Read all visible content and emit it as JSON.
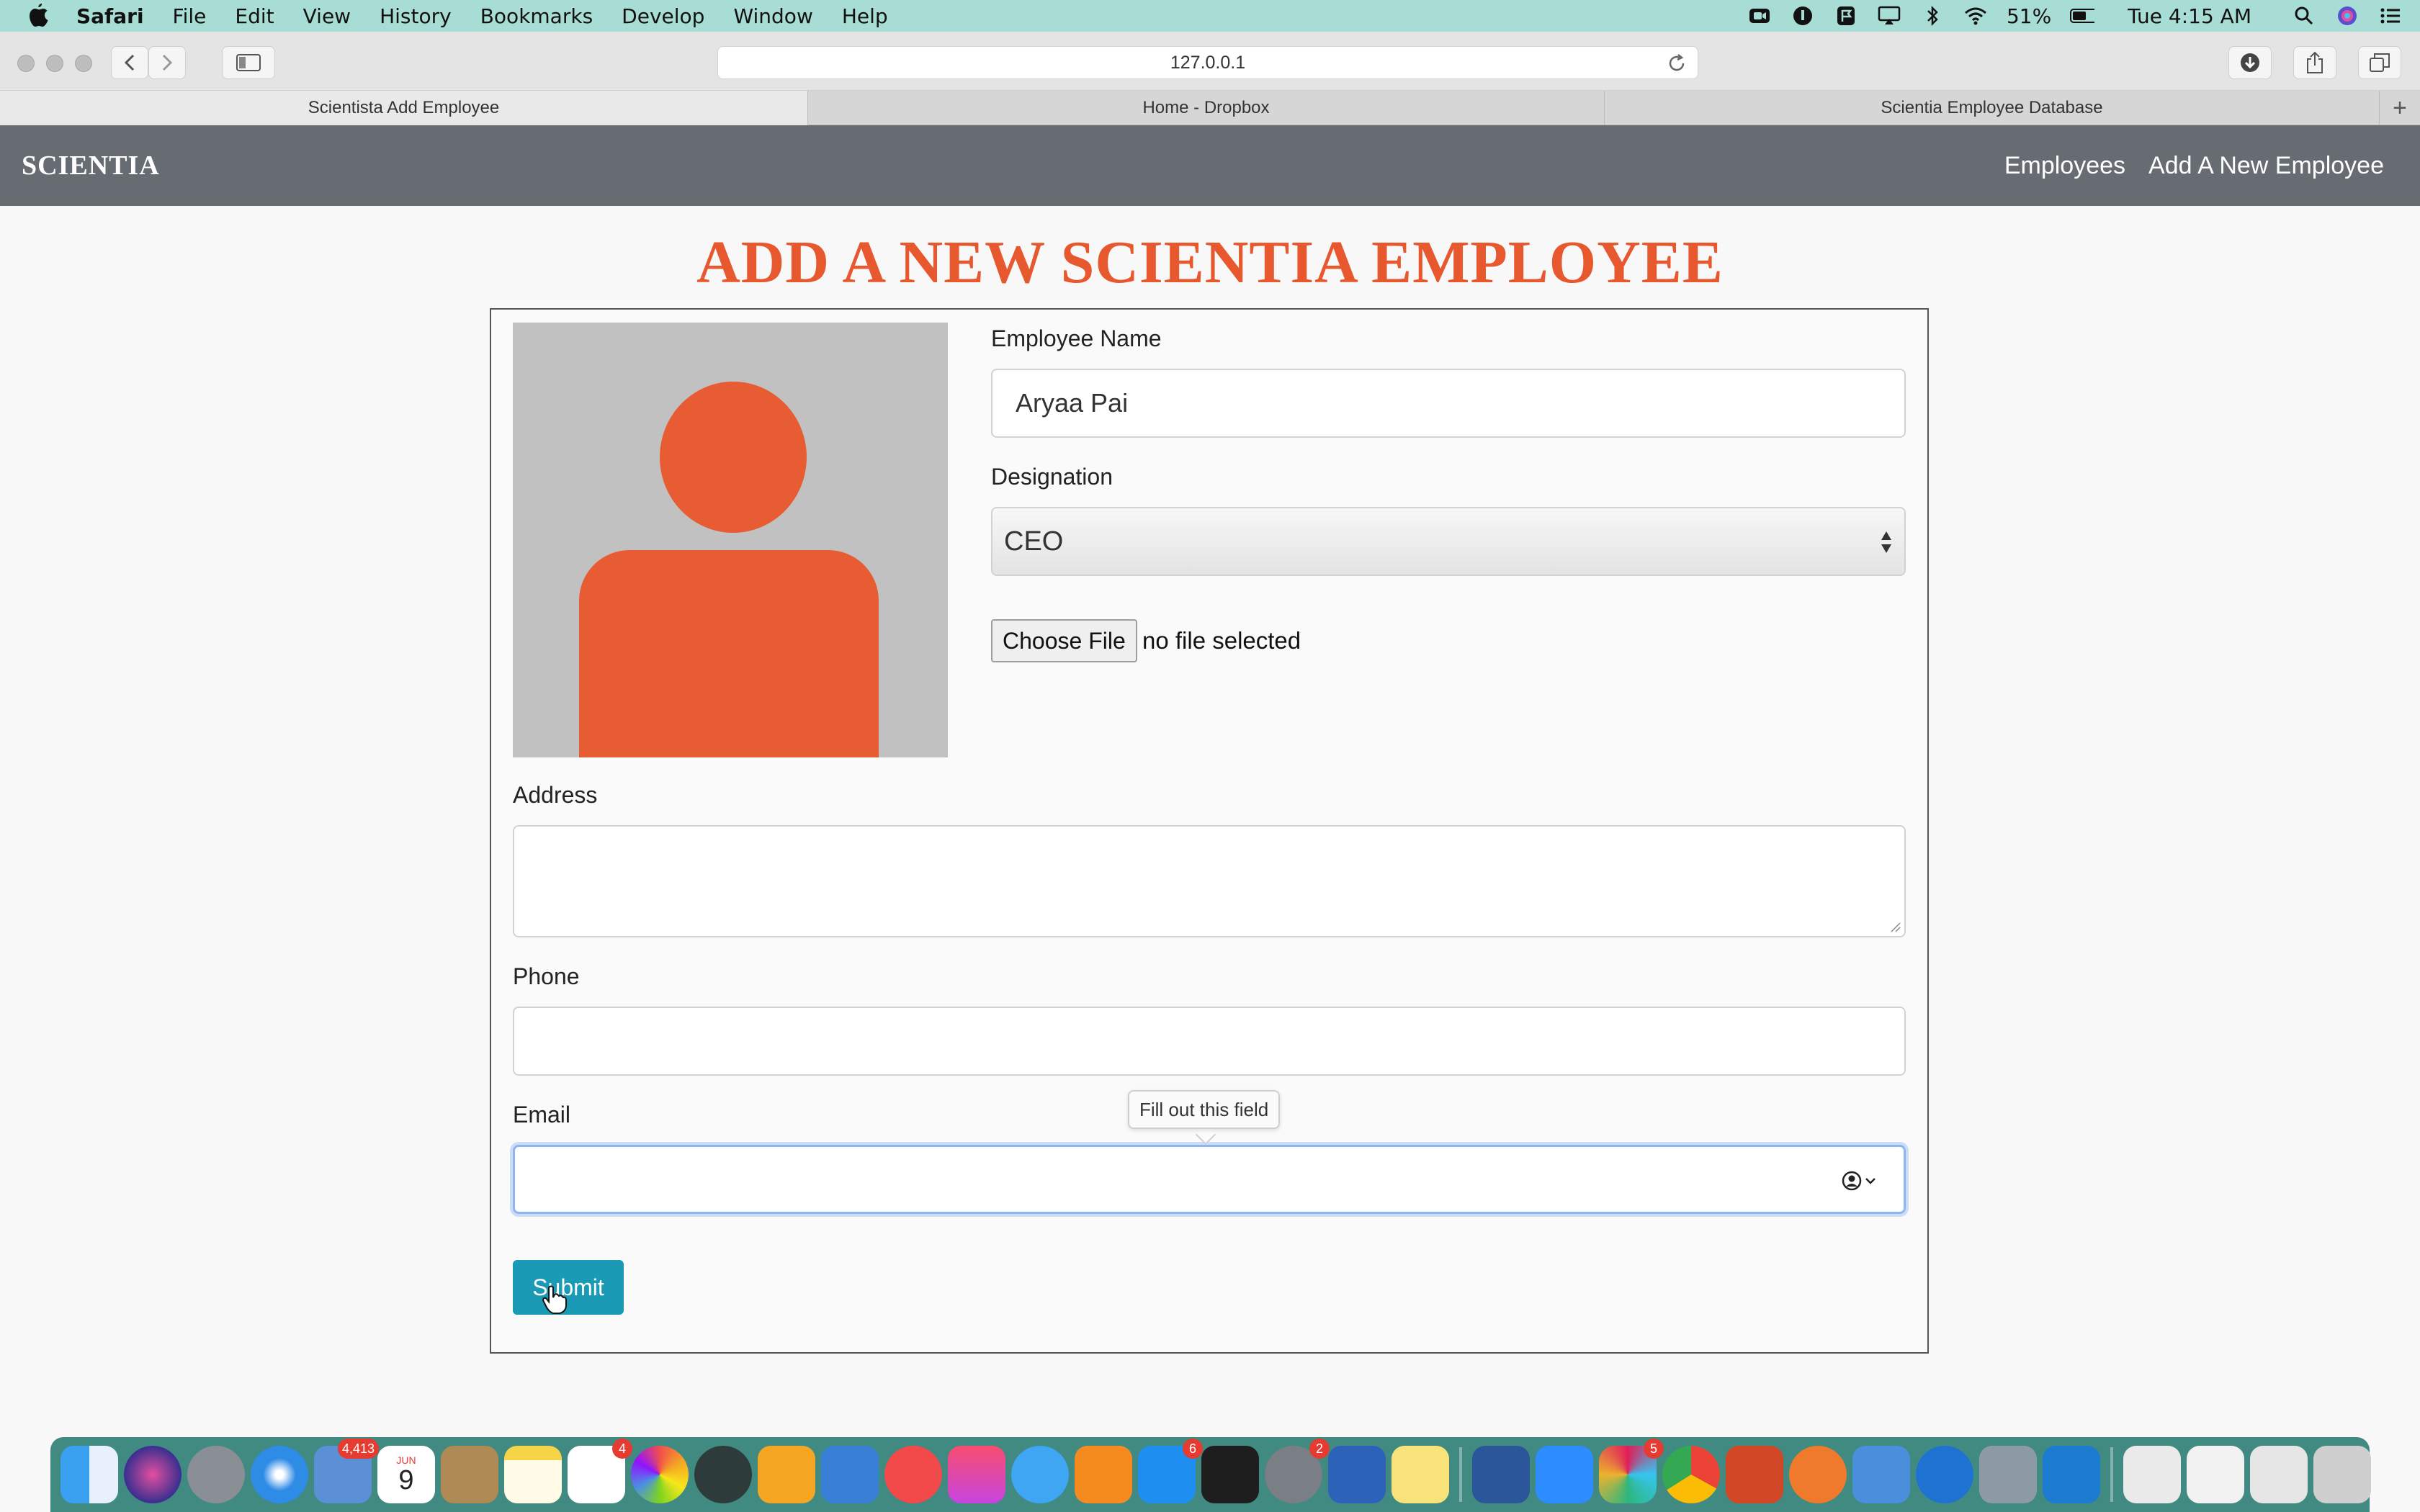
{
  "menubar": {
    "app_name": "Safari",
    "items": [
      "File",
      "Edit",
      "View",
      "History",
      "Bookmarks",
      "Develop",
      "Window",
      "Help"
    ],
    "battery": "51%",
    "clock": "Tue 4:15 AM"
  },
  "browser": {
    "url": "127.0.0.1",
    "tabs": [
      {
        "label": "Scientista Add Employee",
        "active": true
      },
      {
        "label": "Home - Dropbox",
        "active": false
      },
      {
        "label": "Scientia Employee Database",
        "active": false
      }
    ]
  },
  "navbar": {
    "brand": "SCIENTIA",
    "links": [
      "Employees",
      "Add A New Employee"
    ]
  },
  "page": {
    "title": "ADD A NEW SCIENTIA EMPLOYEE"
  },
  "form": {
    "name_label": "Employee Name",
    "name_value": "Aryaa Pai",
    "designation_label": "Designation",
    "designation_value": "CEO",
    "file_button": "Choose File",
    "file_status": "no file selected",
    "address_label": "Address",
    "address_value": "",
    "phone_label": "Phone",
    "phone_value": "",
    "email_label": "Email",
    "email_value": "",
    "validation_tooltip": "Fill out this field",
    "submit_label": "Submit"
  },
  "dock": {
    "badges": {
      "mail": "4,413",
      "calendar_month": "JUN",
      "calendar_day": "9",
      "reminders": "4",
      "app_store": "6",
      "system_prefs": "2",
      "slack": "5"
    }
  },
  "colors": {
    "accent": "#e8582f",
    "navbar": "#676c73",
    "submit": "#1a9ab5",
    "menubar": "#a8ddd5"
  }
}
